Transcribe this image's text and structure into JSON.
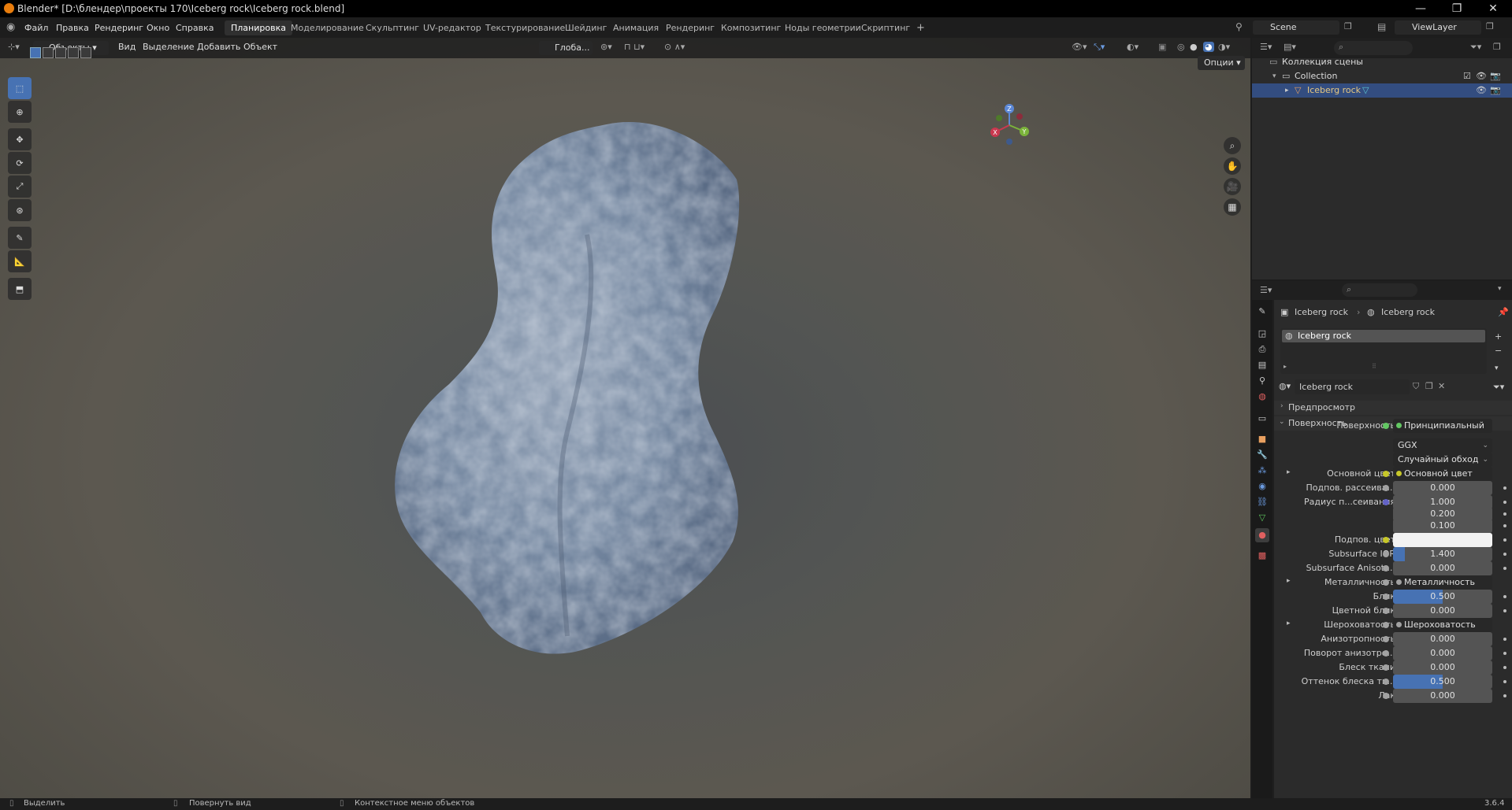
{
  "window": {
    "title": "Blender* [D:\\блендер\\проекты 170\\Iceberg rock\\Iceberg rock.blend]",
    "minimize": "—",
    "maximize": "❐",
    "close": "✕"
  },
  "topbar": {
    "menus": [
      "Файл",
      "Правка",
      "Рендеринг",
      "Окно",
      "Справка"
    ],
    "workspaces": [
      "Планировка",
      "Моделирование",
      "Скульптинг",
      "UV-редактор",
      "Текстурирование",
      "Шейдинг",
      "Анимация",
      "Рендеринг",
      "Композитинг",
      "Ноды геометрии",
      "Скриптинг"
    ],
    "active_workspace": "Планировка",
    "add_tab": "+",
    "scene": "Scene",
    "view_layer": "ViewLayer"
  },
  "viewport": {
    "mode": "Объекты",
    "menus": [
      "Вид",
      "Выделение",
      "Добавить",
      "Объект"
    ],
    "transform_orientation": "Глоба...",
    "options": "Опции",
    "gizmo": {
      "x": "X",
      "y": "Y",
      "z": "Z"
    }
  },
  "outliner": {
    "scene_collection": "Коллекция сцены",
    "collection": "Collection",
    "object": "Iceberg rock"
  },
  "properties": {
    "breadcrumb_object": "Iceberg rock",
    "breadcrumb_material": "Iceberg rock",
    "slot_name": "Iceberg rock",
    "material_name": "Iceberg rock",
    "panel_preview": "Предпросмотр",
    "panel_surface": "Поверхность",
    "rows": [
      {
        "label": "Поверхность",
        "value": "Принципиальный BSDF",
        "kind": "link",
        "socket": "#63c763"
      },
      {
        "label": "",
        "value": "GGX",
        "kind": "dropdown"
      },
      {
        "label": "",
        "value": "Случайный обход",
        "kind": "dropdown"
      },
      {
        "label": "Основной цвет",
        "value": "Основной цвет",
        "kind": "link",
        "socket": "#c7c729",
        "expand": "▸"
      },
      {
        "label": "Подпов. рассеива...",
        "value": "0.000",
        "kind": "num",
        "socket": "#a1a1a1"
      },
      {
        "label": "Радиус п...сеивания",
        "value": "1.000",
        "kind": "num",
        "socket": "#6363c7"
      },
      {
        "label": "",
        "value": "0.200",
        "kind": "num"
      },
      {
        "label": "",
        "value": "0.100",
        "kind": "num"
      },
      {
        "label": "Подпов. цвет",
        "value": "",
        "kind": "color",
        "socket": "#c7c729"
      },
      {
        "label": "Subsurface IOR",
        "value": "1.400",
        "kind": "bar",
        "fill": 0.12,
        "socket": "#a1a1a1"
      },
      {
        "label": "Subsurface Anisotr...",
        "value": "0.000",
        "kind": "num",
        "socket": "#a1a1a1"
      },
      {
        "label": "Металличность",
        "value": "Металличность",
        "kind": "link",
        "socket": "#a1a1a1",
        "expand": "▸"
      },
      {
        "label": "Блик",
        "value": "0.500",
        "kind": "bar",
        "fill": 0.5,
        "socket": "#a1a1a1"
      },
      {
        "label": "Цветной блик",
        "value": "0.000",
        "kind": "num",
        "socket": "#a1a1a1"
      },
      {
        "label": "Шероховатость",
        "value": "Шероховатость",
        "kind": "link",
        "socket": "#a1a1a1",
        "expand": "▸"
      },
      {
        "label": "Анизотропность",
        "value": "0.000",
        "kind": "num",
        "socket": "#a1a1a1"
      },
      {
        "label": "Поворот анизотро...",
        "value": "0.000",
        "kind": "num",
        "socket": "#a1a1a1"
      },
      {
        "label": "Блеск ткани",
        "value": "0.000",
        "kind": "num",
        "socket": "#a1a1a1"
      },
      {
        "label": "Оттенок блеска тк...",
        "value": "0.500",
        "kind": "bar",
        "fill": 0.5,
        "socket": "#a1a1a1"
      },
      {
        "label": "Лак",
        "value": "0.000",
        "kind": "num",
        "socket": "#a1a1a1"
      }
    ]
  },
  "statusbar": {
    "select": "Выделить",
    "rotate": "Повернуть вид",
    "context": "Контекстное меню объектов",
    "version": "3.6.4"
  },
  "colors": {
    "accent": "#4772b3",
    "selection": "#334d80",
    "brand": "#e87d0d"
  }
}
